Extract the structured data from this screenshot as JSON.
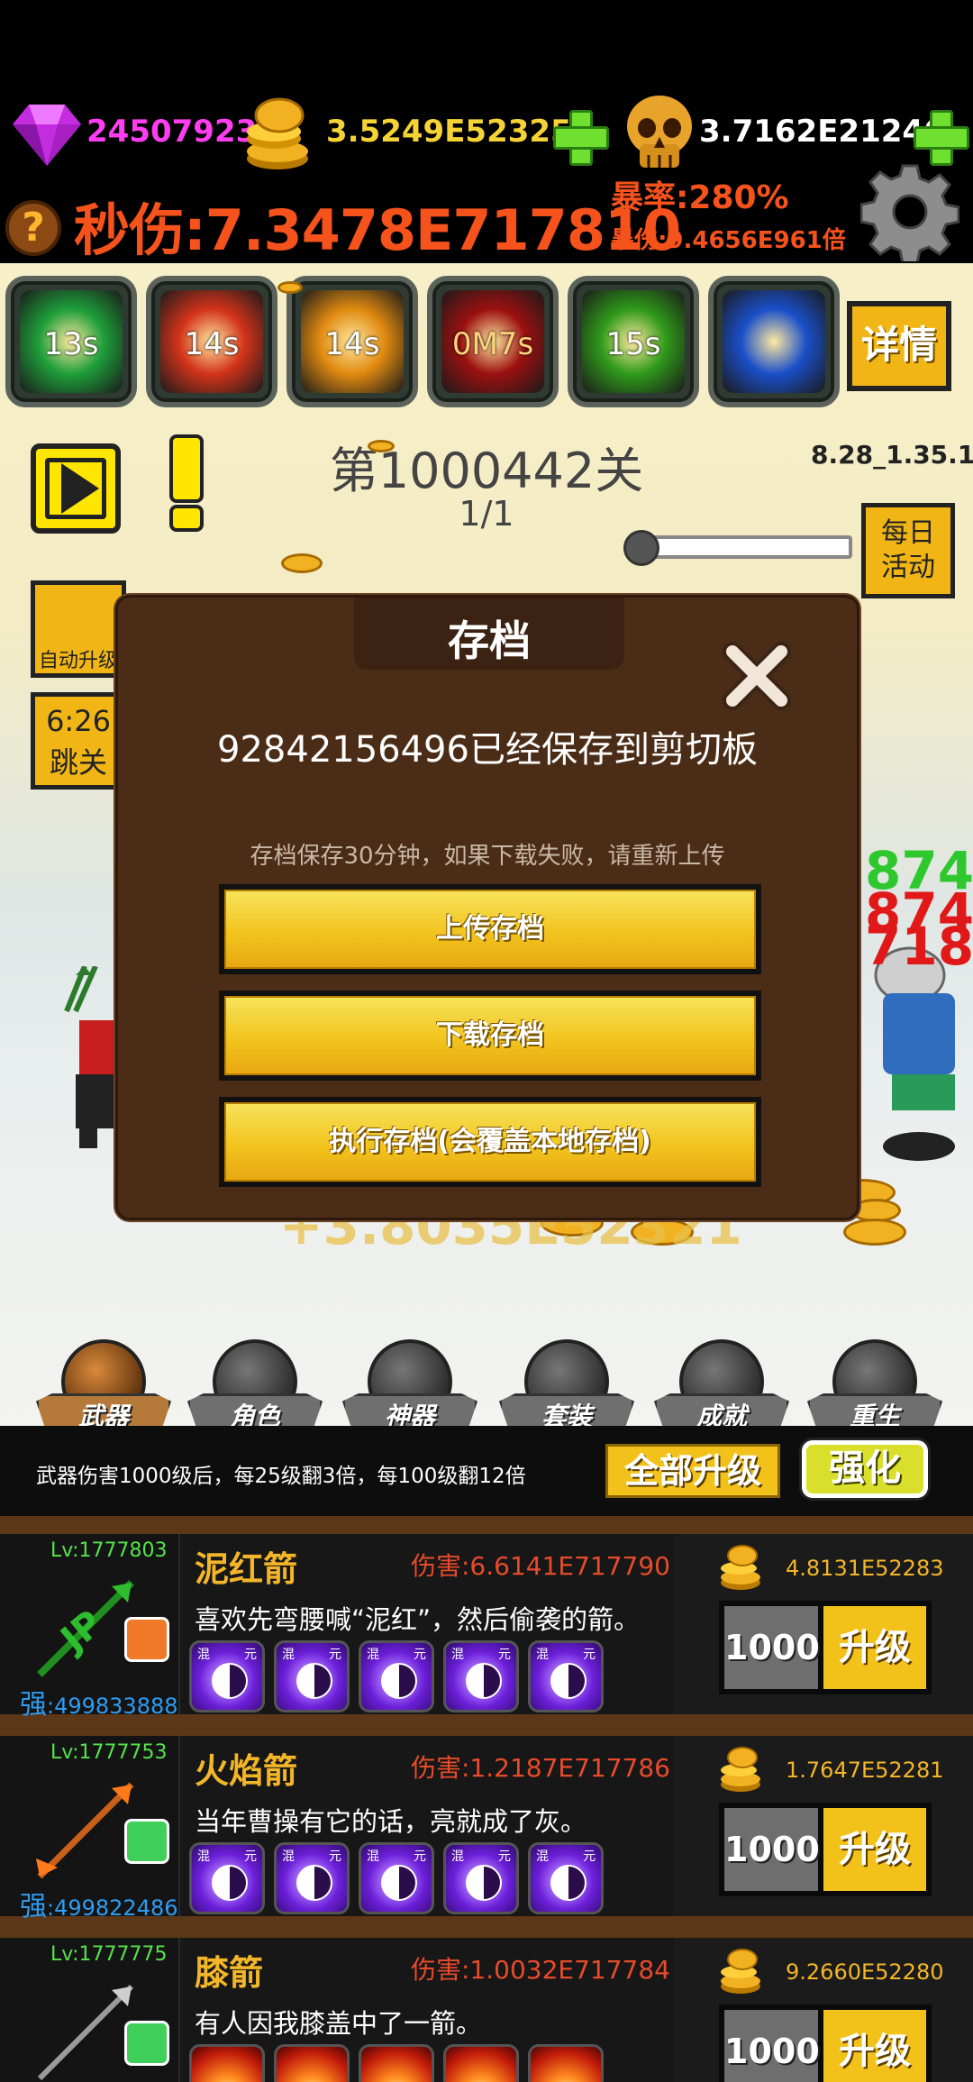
{
  "resources": {
    "gems": "24507923",
    "gold": "3.5249E52325",
    "skulls": "3.7162E21246"
  },
  "stats": {
    "dps": "秒伤:7.3478E717810",
    "crit_rate": "暴率:280%",
    "crit_damage": "暴伤:9.4656E961倍"
  },
  "skills": [
    {
      "cooldown": "13s",
      "color": "#1e9e3a"
    },
    {
      "cooldown": "14s",
      "color": "#d3331a"
    },
    {
      "cooldown": "14s",
      "color": "#e08a10"
    },
    {
      "cooldown": "0M7s",
      "color": "#9c1010"
    },
    {
      "cooldown": "15s",
      "color": "#2f9a1a"
    },
    {
      "cooldown": "",
      "color": "#1a4fc9"
    }
  ],
  "buttons": {
    "details": "详情",
    "daily_line1": "每日",
    "daily_line2": "活动",
    "auto_upgrade": "自动升级",
    "skip_timer": "6:26",
    "skip_label": "跳关"
  },
  "stage": {
    "title": "第1000442关",
    "wave": "1/1",
    "version": "8.28_1.35.1",
    "progress": 0.0
  },
  "modal": {
    "title": "存档",
    "message": "92842156496已经保存到剪切板",
    "note": "存档保存30分钟，如果下载失败，请重新上传",
    "upload": "上传存档",
    "download": "下载存档",
    "execute": "执行存档(会覆盖本地存档)"
  },
  "nav": [
    {
      "label": "武器",
      "icon": "weapon-icon",
      "active": true
    },
    {
      "label": "角色",
      "icon": "character-icon",
      "active": false
    },
    {
      "label": "神器",
      "icon": "artifact-icon",
      "active": false
    },
    {
      "label": "套装",
      "icon": "armor-set-icon",
      "active": false
    },
    {
      "label": "成就",
      "icon": "achievement-book-icon",
      "active": false
    },
    {
      "label": "重生",
      "icon": "rebirth-flame-icon",
      "active": false
    }
  ],
  "weapon_panel": {
    "info": "武器伤害1000级后，每25级翻3倍，每100级翻12倍",
    "upgrade_all": "全部升级",
    "enhance": "强化"
  },
  "weapons": [
    {
      "level": "Lv:1777803",
      "strength_prefix": "强",
      "strength": ":499833888",
      "name": "泥红箭",
      "damage": "伤害:6.6141E717790",
      "desc": "喜欢先弯腰喊“泥红”，然后偷袭的箭。",
      "cost": "4.8131E52283",
      "qty": "1000",
      "upgrade": "升级",
      "orb_tag1": "混",
      "orb_tag2": "元"
    },
    {
      "level": "Lv:1777753",
      "strength_prefix": "强",
      "strength": ":499822486",
      "name": "火焰箭",
      "damage": "伤害:1.2187E717786",
      "desc": "当年曹操有它的话，亮就成了灰。",
      "cost": "1.7647E52281",
      "qty": "1000",
      "upgrade": "升级",
      "orb_tag1": "混",
      "orb_tag2": "元"
    },
    {
      "level": "Lv:1777775",
      "name": "膝箭",
      "damage": "伤害:1.0032E717784",
      "desc": "有人因我膝盖中了一箭。",
      "cost": "9.2660E52280",
      "qty": "1000",
      "upgrade": "升级"
    }
  ],
  "floating": {
    "damage_ghost": "+3.8035E52321",
    "dmg_a": "874",
    "dmg_b": "874",
    "dmg_c": "718"
  }
}
